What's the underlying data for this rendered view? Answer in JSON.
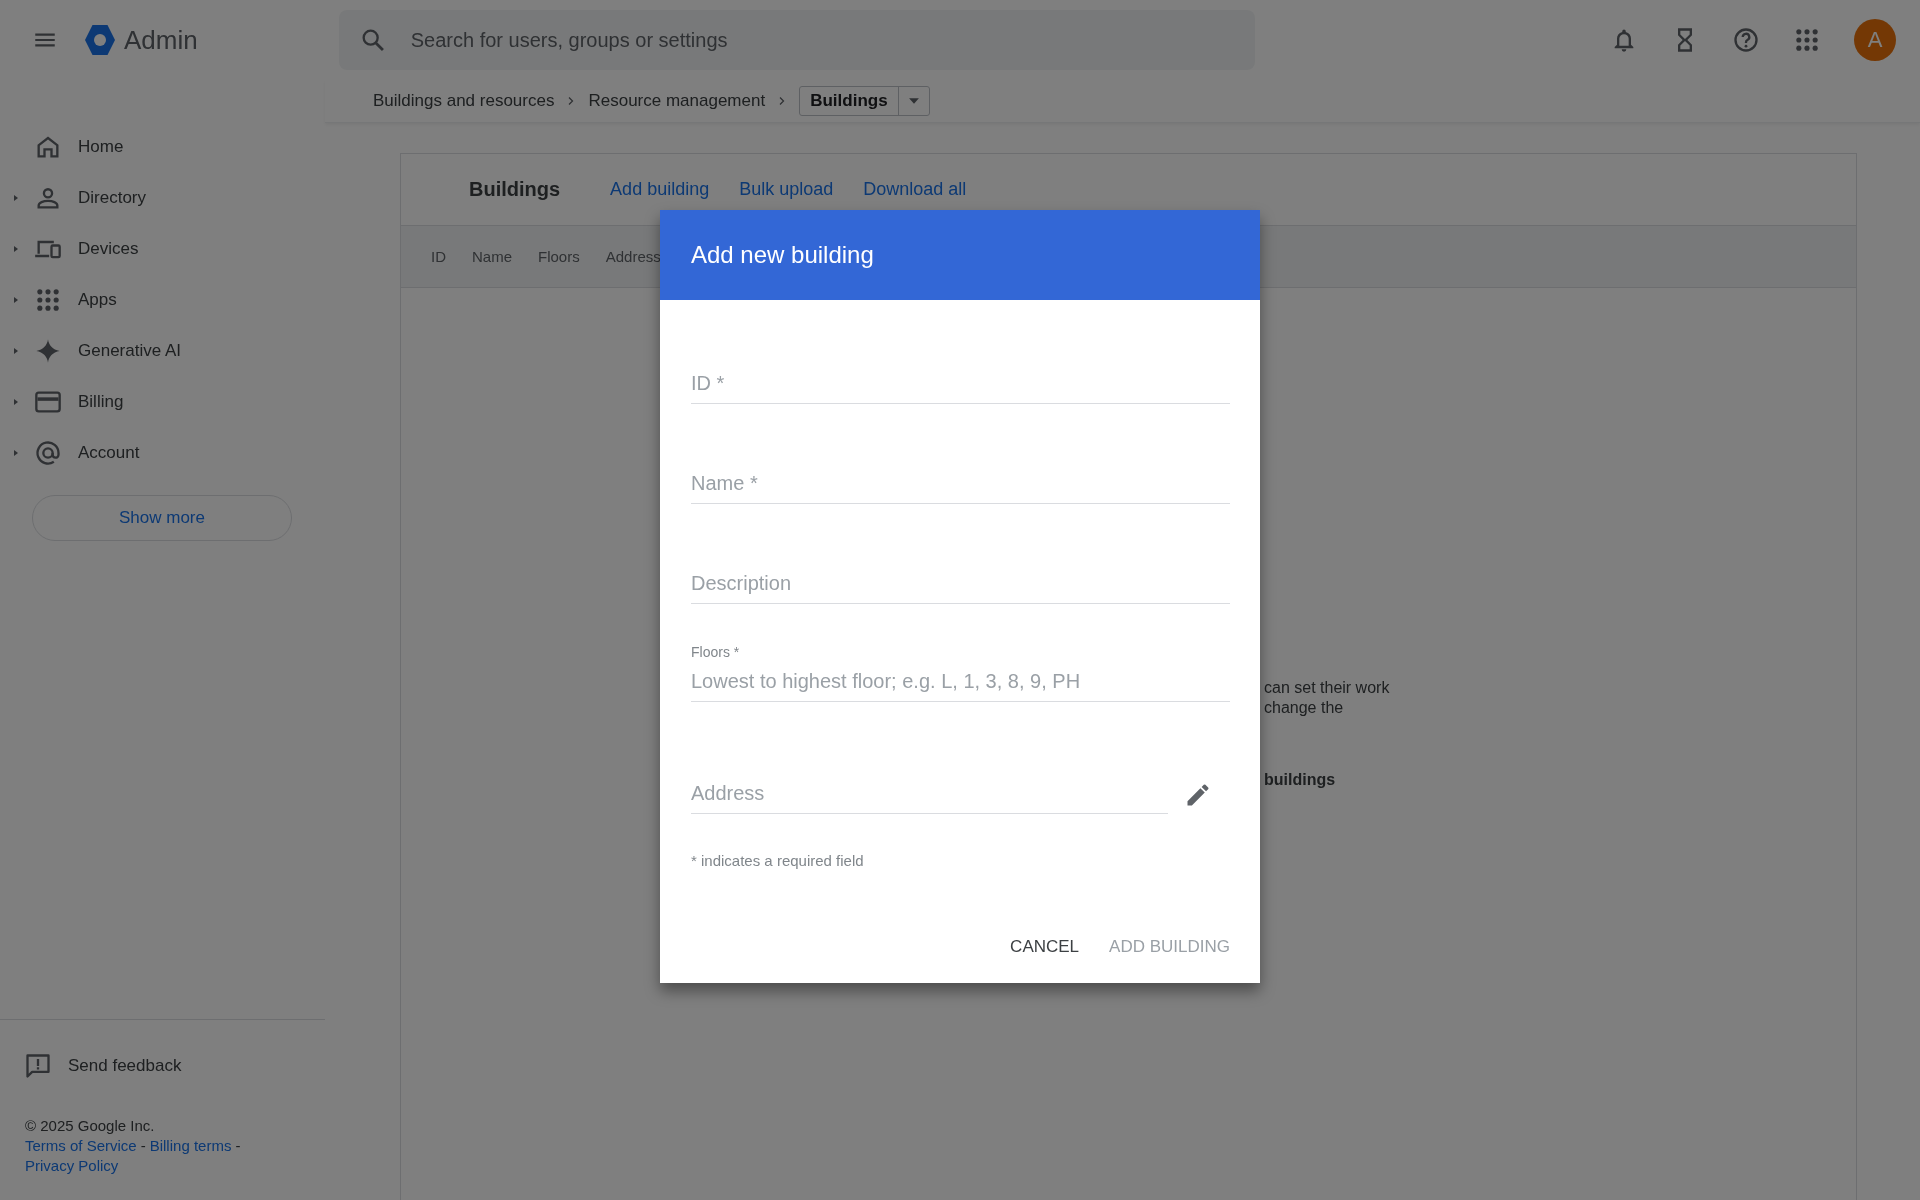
{
  "header": {
    "product": "Admin",
    "search": {
      "placeholder": "Search for users, groups or settings"
    },
    "avatar": "A"
  },
  "breadcrumb": {
    "items": [
      "Buildings and resources",
      "Resource management"
    ],
    "current": "Buildings"
  },
  "sidebar": {
    "items": [
      {
        "label": "Home",
        "expandable": false
      },
      {
        "label": "Directory",
        "expandable": true
      },
      {
        "label": "Devices",
        "expandable": true
      },
      {
        "label": "Apps",
        "expandable": true
      },
      {
        "label": "Generative AI",
        "expandable": true
      },
      {
        "label": "Billing",
        "expandable": true
      },
      {
        "label": "Account",
        "expandable": true
      }
    ],
    "show_more": "Show more",
    "feedback": "Send feedback",
    "copyright": "© 2025 Google Inc.",
    "links": [
      "Terms of Service",
      "Billing terms",
      "Privacy Policy"
    ],
    "separator": "-"
  },
  "card": {
    "title": "Buildings",
    "actions": [
      "Add building",
      "Bulk upload",
      "Download all"
    ],
    "columns": [
      "ID",
      "Name",
      "Floors",
      "Address"
    ],
    "fragments": [
      {
        "kind": "text",
        "text": "can set their work"
      },
      {
        "kind": "text",
        "text": "change the"
      },
      {
        "kind": "heading",
        "text": "buildings"
      }
    ]
  },
  "dialog": {
    "title": "Add new building",
    "fields": [
      {
        "kind": "plain",
        "placeholder": "ID *"
      },
      {
        "kind": "plain",
        "placeholder": "Name *"
      },
      {
        "kind": "plain",
        "placeholder": "Description"
      },
      {
        "kind": "labeled",
        "label": "Floors *",
        "placeholder": "Lowest to highest floor; e.g. L, 1, 3, 8, 9, PH"
      },
      {
        "kind": "address",
        "placeholder": "Address"
      }
    ],
    "note": "* indicates a required field",
    "buttons": [
      {
        "label": "CANCEL",
        "disabled": false
      },
      {
        "label": "ADD BUILDING",
        "disabled": true
      }
    ]
  }
}
